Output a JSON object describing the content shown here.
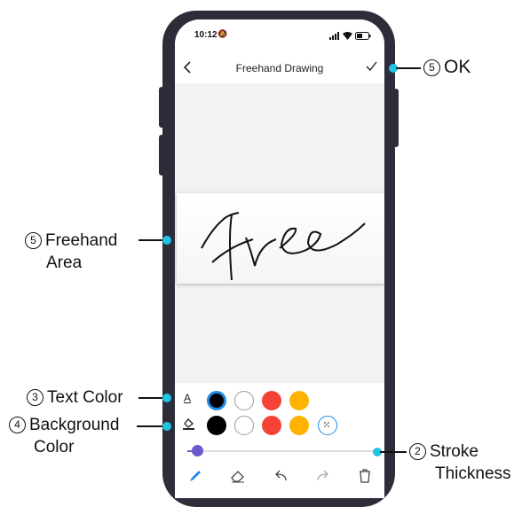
{
  "status": {
    "time": "10:12",
    "signal_icon": "signal-icon",
    "wifi_icon": "wifi-icon",
    "battery_icon": "battery-icon"
  },
  "nav": {
    "title": "Freehand Drawing",
    "back_icon": "chevron-left-icon",
    "ok_icon": "checkmark-icon"
  },
  "canvas": {
    "drawn_text": "Free"
  },
  "text_color": {
    "icon": "text-color-icon",
    "swatches": [
      "#000000",
      "#ffffff",
      "#f44336",
      "#ffb300"
    ],
    "selected": "#000000"
  },
  "background_color": {
    "icon": "fill-color-icon",
    "swatches": [
      "#000000",
      "#ffffff",
      "#f44336",
      "#ffb300",
      "transparent"
    ]
  },
  "stroke": {
    "level": 0.05,
    "accent": "#6a5acd"
  },
  "tools": [
    "pen-icon",
    "eraser-icon",
    "undo-icon",
    "redo-icon",
    "trash-icon"
  ],
  "callouts": {
    "ok": {
      "num": "5",
      "text": "OK"
    },
    "freehand": {
      "num": "5",
      "line1": "Freehand",
      "line2": "Area"
    },
    "text_color": {
      "num": "3",
      "text": "Text Color"
    },
    "background": {
      "num": "4",
      "line1": "Background",
      "line2": "Color"
    },
    "stroke": {
      "num": "2",
      "line1": "Stroke",
      "line2": "Thickness"
    }
  },
  "colors": {
    "callout_dot": "#1ec3e6",
    "phone_frame": "#2d2d3a"
  }
}
